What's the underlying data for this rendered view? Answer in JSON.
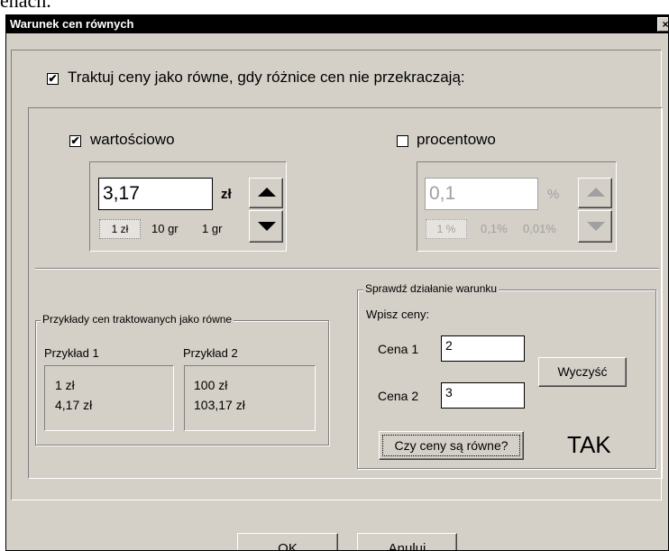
{
  "background_text": "enach.",
  "dialog": {
    "title": "Warunek cen równych",
    "close_glyph": "×",
    "main_checkbox": {
      "label": "Traktuj ceny jako równe, gdy różnice cen nie przekraczają:",
      "checked": true
    }
  },
  "value_mode": {
    "label": "wartościowo",
    "checked": true,
    "amount": "3,17",
    "unit": "zł",
    "steps": [
      "1 zł",
      "10 gr",
      "1 gr"
    ]
  },
  "percent_mode": {
    "label": "procentowo",
    "checked": false,
    "amount": "0,1",
    "unit": "%",
    "steps": [
      "1 %",
      "0,1%",
      "0,01%"
    ]
  },
  "examples": {
    "legend": "Przykłady cen traktowanych jako równe",
    "example1": {
      "title": "Przykład 1",
      "line1": "1 zł",
      "line2": "4,17 zł"
    },
    "example2": {
      "title": "Przykład 2",
      "line1": "100 zł",
      "line2": "103,17 zł"
    }
  },
  "check": {
    "legend": "Sprawdź działanie warunku",
    "prompt": "Wpisz ceny:",
    "price1_label": "Cena 1",
    "price1_value": "2",
    "price2_label": "Cena 2",
    "price2_value": "3",
    "clear_button": "Wyczyść",
    "test_button": "Czy ceny są równe?",
    "result": "TAK"
  },
  "footer": {
    "ok": "OK",
    "cancel": "Anuluj"
  }
}
